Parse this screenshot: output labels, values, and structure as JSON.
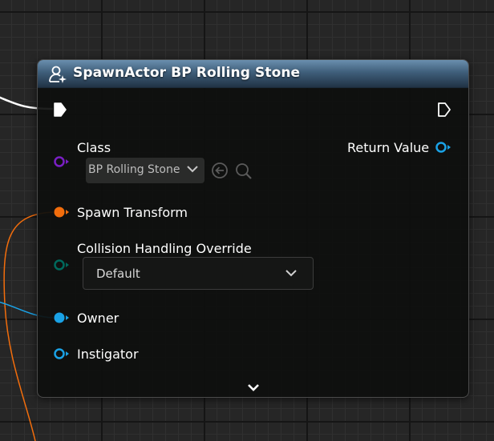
{
  "node": {
    "title": "SpawnActor BP Rolling Stone",
    "icon": "spawn-actor-icon"
  },
  "pins": {
    "exec_in": {
      "icon": "exec-in-pin-icon"
    },
    "exec_out": {
      "icon": "exec-out-pin-icon"
    },
    "class": {
      "label": "Class",
      "value": "BP Rolling Stone",
      "color": "#7a1fc4"
    },
    "return_value": {
      "label": "Return Value",
      "color": "#1aa2e6"
    },
    "spawn_transform": {
      "label": "Spawn Transform",
      "color": "#f26d0c"
    },
    "collision": {
      "label": "Collision Handling Override",
      "value": "Default",
      "color": "#00695c"
    },
    "owner": {
      "label": "Owner",
      "color": "#1aa2e6"
    },
    "instigator": {
      "label": "Instigator",
      "color": "#1aa2e6"
    }
  },
  "buttons": {
    "use_selected": "arrow-left-circle-icon",
    "browse": "magnifier-icon",
    "expand": "chevron-down-icon"
  }
}
